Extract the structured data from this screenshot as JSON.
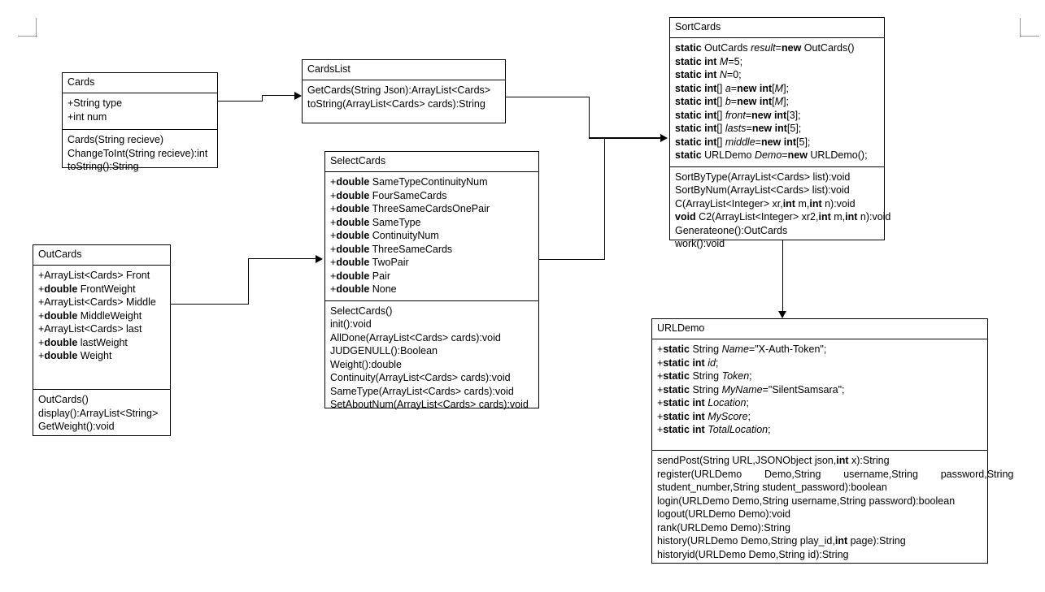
{
  "diagram": {
    "title": "UML Class Diagram",
    "type": "uml-class-diagram",
    "background": "#ffffff",
    "line_color": "#000000"
  },
  "classes": {
    "cards": {
      "name": "Cards",
      "attributes": [
        "+String type",
        "+int num"
      ],
      "methods": [
        "Cards(String recieve)",
        "ChangeToInt(String recieve):int",
        "toString():String"
      ]
    },
    "cardslist": {
      "name": "CardsList",
      "attributes": [],
      "methods": [
        "GetCards(String Json):ArrayList<Cards>",
        "toString(ArrayList<Cards> cards):String"
      ]
    },
    "sortcards": {
      "name": "SortCards",
      "attributes": [
        "static OutCards result=new OutCards()",
        "static int M=5;",
        "static int N=0;",
        "static int[] a=new int[M];",
        "static int[] b=new int[M];",
        "static int[] front=new int[3];",
        "static int[] lasts=new int[5];",
        "static int[] middle=new int[5];",
        "static URLDemo Demo=new URLDemo();"
      ],
      "methods": [
        "SortByType(ArrayList<Cards> list):void",
        "SortByNum(ArrayList<Cards> list):void",
        "C(ArrayList<Integer> xr,int m,int n):void",
        "void C2(ArrayList<Integer> xr2,int m,int n):void",
        "Generateone():OutCards",
        "work():void"
      ]
    },
    "selectcards": {
      "name": "SelectCards",
      "attributes": [
        "+double SameTypeContinuityNum",
        "+double FourSameCards",
        "+double ThreeSameCardsOnePair",
        "+double SameType",
        "+double ContinuityNum",
        "+double ThreeSameCards",
        "+double TwoPair",
        "+double Pair",
        "+double None"
      ],
      "methods": [
        "SelectCards()",
        "init():void",
        "AllDone(ArrayList<Cards> cards):void",
        "JUDGENULL():Boolean",
        "Weight():double",
        "Continuity(ArrayList<Cards> cards):void",
        "SameType(ArrayList<Cards> cards):void",
        "SetAboutNum(ArrayList<Cards> cards):void"
      ]
    },
    "outcards": {
      "name": "OutCards",
      "attributes": [
        "+ArrayList<Cards> Front",
        "+double FrontWeight",
        "+ArrayList<Cards> Middle",
        "+double MiddleWeight",
        "+ArrayList<Cards> last",
        "+double lastWeight",
        "+double Weight"
      ],
      "methods": [
        "OutCards()",
        "display():ArrayList<String>",
        "GetWeight():void"
      ]
    },
    "urldemo": {
      "name": "URLDemo",
      "attributes": [
        "+static String Name=\"X-Auth-Token\";",
        "+static int id;",
        "+static String Token;",
        "+static String MyName=\"SilentSamsara\";",
        "+static int Location;",
        "+static int MyScore;",
        "+static int TotalLocation;"
      ],
      "methods": [
        "sendPost(String URL,JSONObject json,int x):String",
        "register(URLDemo     Demo,String     username,String     password,String student_number,String student_password):boolean",
        "login(URLDemo Demo,String username,String password):boolean",
        "logout(URLDemo Demo):void",
        "rank(URLDemo Demo):String",
        "history(URLDemo Demo,String play_id,int page):String",
        "historyid(URLDemo Demo,String id):String"
      ]
    }
  },
  "relations": [
    {
      "from": "Cards",
      "to": "CardsList",
      "kind": "association-arrow"
    },
    {
      "from": "CardsList",
      "to": "SortCards",
      "kind": "association-arrow"
    },
    {
      "from": "SelectCards",
      "to": "SortCards",
      "kind": "association-arrow"
    },
    {
      "from": "OutCards",
      "to": "SelectCards",
      "kind": "association-arrow"
    },
    {
      "from": "SortCards",
      "to": "URLDemo",
      "kind": "association-arrow"
    }
  ]
}
